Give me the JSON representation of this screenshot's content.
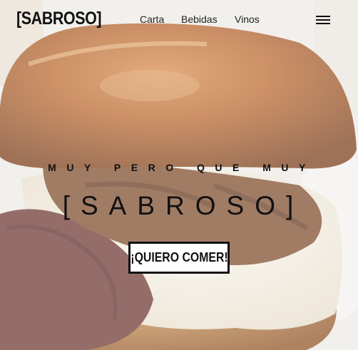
{
  "header": {
    "logo": "[SABROSO]",
    "nav": [
      "Carta",
      "Bebidas",
      "Vinos"
    ],
    "menu_icon": "hamburger-menu-icon"
  },
  "hero": {
    "tagline": "MUY PERO QUE MUY",
    "brand": "[SABROSO]",
    "cta_label": "¡QUIERO COMER!",
    "image_subject": "burger-photo"
  },
  "colors": {
    "text": "#111111",
    "bun": "#b8662c",
    "background": "#efe9e4"
  }
}
